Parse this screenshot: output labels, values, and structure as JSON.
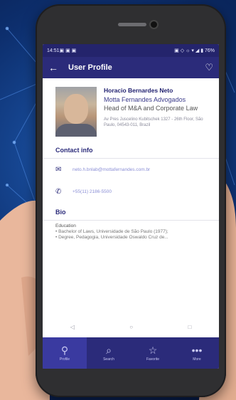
{
  "statusbar": {
    "time": "14:51",
    "icons_left": "▣ ▣ ▣",
    "icons_right": "▣ ◇ ☼ ▾ ◢ ▮ 76%"
  },
  "appbar": {
    "title": "User Profile",
    "back_icon": "←",
    "favorite_icon": "♡"
  },
  "profile": {
    "name": "Horacio Bernardes Neto",
    "company": "Motta Fernandes Advogados",
    "role": "Head of M&A and Corporate Law",
    "address": "Av Pres Juscelino Kubitschek 1327 - 26th Floor, São Paulo, 04543-011, Brazil"
  },
  "contact": {
    "heading": "Contact info",
    "email": "neto.h.bnlab@mottafernandes.com.br",
    "phone": "+55(11) 2186-5500"
  },
  "bio": {
    "heading": "Bio",
    "label": "Education",
    "line1": "• Bachelor of Laws, Universidade de São Paulo (1977);",
    "line2": "• Degree, Pedagogia, Universidade Oswaldo Cruz de..."
  },
  "navkeys": [
    "◁",
    "○",
    "□"
  ],
  "tabs": [
    {
      "label": "Profile",
      "icon": "⚲"
    },
    {
      "label": "Search",
      "icon": "⌕"
    },
    {
      "label": "Favorite",
      "icon": "☆"
    },
    {
      "label": "More",
      "icon": "•••"
    }
  ]
}
